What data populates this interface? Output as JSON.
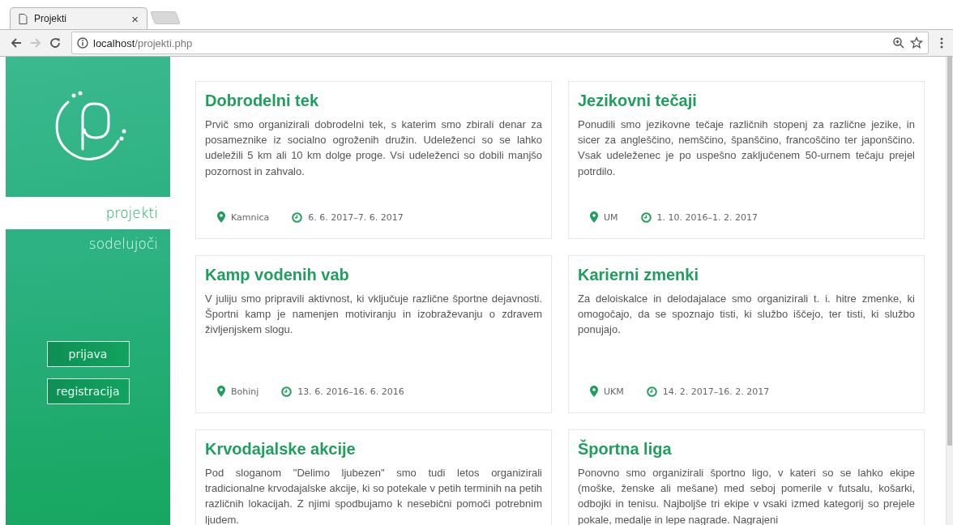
{
  "browser": {
    "tab": {
      "title": "Projekti",
      "close": "×"
    },
    "back": {
      "disabled": false
    },
    "forward": {
      "disabled": true
    },
    "address": {
      "host": "localhost",
      "path": "/projekti.php"
    }
  },
  "sidebar": {
    "nav": [
      {
        "label": "projekti",
        "selected": true
      },
      {
        "label": "sodelujoči",
        "selected": false
      }
    ],
    "buttons": [
      "prijava",
      "registracija"
    ]
  },
  "projects": [
    {
      "title": "Dobrodelni tek",
      "text": "Prvič smo organizirali dobrodelni tek, s katerim smo zbirali denar za posameznike iz socialno ogroženih družin. Udeleženci so se lahko udeležili 5 km ali 10 km dolge proge. Vsi udeleženci so dobili manjšo pozornost in zahvalo.",
      "location": "Kamnica",
      "dates": "6. 6. 2017–7. 6. 2017"
    },
    {
      "title": "Jezikovni tečaji",
      "text": "Ponudili smo jezikovne tečaje različnih stopenj za različne jezike, in sicer za angleščino, nemščino, španščino, francoščino ter japonščino. Vsak udeleženec je po uspešno zaključenem 50-urnem tečaju prejel potrdilo.",
      "location": "UM",
      "dates": "1. 10. 2016–1. 2. 2017"
    },
    {
      "title": "Kamp vodenih vab",
      "text": "V juliju smo pripravili aktivnost, ki vključuje različne športne dejavnosti. Športni kamp je namenjen motiviranju in izobraževanju o zdravem življenjskem slogu.",
      "location": "Bohinj",
      "dates": "13. 6. 2016–16. 6. 2016"
    },
    {
      "title": "Karierni zmenki",
      "text": "Za deloiskalce in delodajalace smo organizirali t. i. hitre zmenke, ki omogočajo, da se spoznajo tisti, ki službo iščejo, ter tisti, ki službo ponujajo.",
      "location": "UKM",
      "dates": "14. 2. 2017–16. 2. 2017"
    },
    {
      "title": "Krvodajalske akcije",
      "text": "Pod sloganom \"Delimo ljubezen\" smo tudi letos organizirali tradicionalne krvodajalske akcije, ki so potekale v petih terminih na petih različnih lokacijah. Z njimi spodbujamo k nesebični pomoči potrebnim ljudem."
    },
    {
      "title": "Športna liga",
      "text": "Ponovno smo organizirali športno ligo, v kateri so se lahko ekipe (moške, ženske ali mešane) med seboj pomerile v futsalu, košarki, odbojki in tenisu. Najboljše tri ekipe v vsaki izmed kategorij so prejele pokale, medalje in lepe nagrade. Nagrajeni"
    }
  ]
}
